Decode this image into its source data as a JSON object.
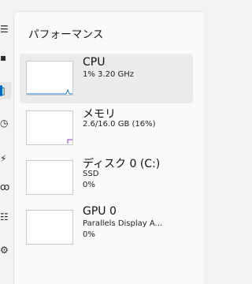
{
  "panel": {
    "title": "パフォーマンス"
  },
  "nav": {
    "icons": [
      {
        "name": "menu-icon",
        "glyph": "☰"
      },
      {
        "name": "processes-icon",
        "glyph": "▪"
      },
      {
        "name": "performance-icon",
        "glyph": "▯",
        "selected": true
      },
      {
        "name": "app-history-icon",
        "glyph": "◷"
      },
      {
        "name": "startup-apps-icon",
        "glyph": "⚡"
      },
      {
        "name": "users-icon",
        "glyph": "ꝏ"
      },
      {
        "name": "details-icon",
        "glyph": "☷"
      },
      {
        "name": "services-icon",
        "glyph": "⚙"
      }
    ]
  },
  "items": [
    {
      "name": "cpu",
      "title": "CPU",
      "line1": "1%  3.20 GHz",
      "line2": "",
      "accent": "#1a75c9",
      "selected": true
    },
    {
      "name": "memory",
      "title": "メモリ",
      "line1": "2.6/16.0 GB (16%)",
      "line2": "",
      "accent": "#8b2fc9",
      "selected": false
    },
    {
      "name": "disk",
      "title": "ディスク 0 (C:)",
      "line1": "SSD",
      "line2": "0%",
      "accent": "#3a8f2a",
      "selected": false
    },
    {
      "name": "gpu",
      "title": "GPU 0",
      "line1": "Parallels Display A...",
      "line2": "0%",
      "accent": "#2b6cb0",
      "selected": false
    }
  ]
}
